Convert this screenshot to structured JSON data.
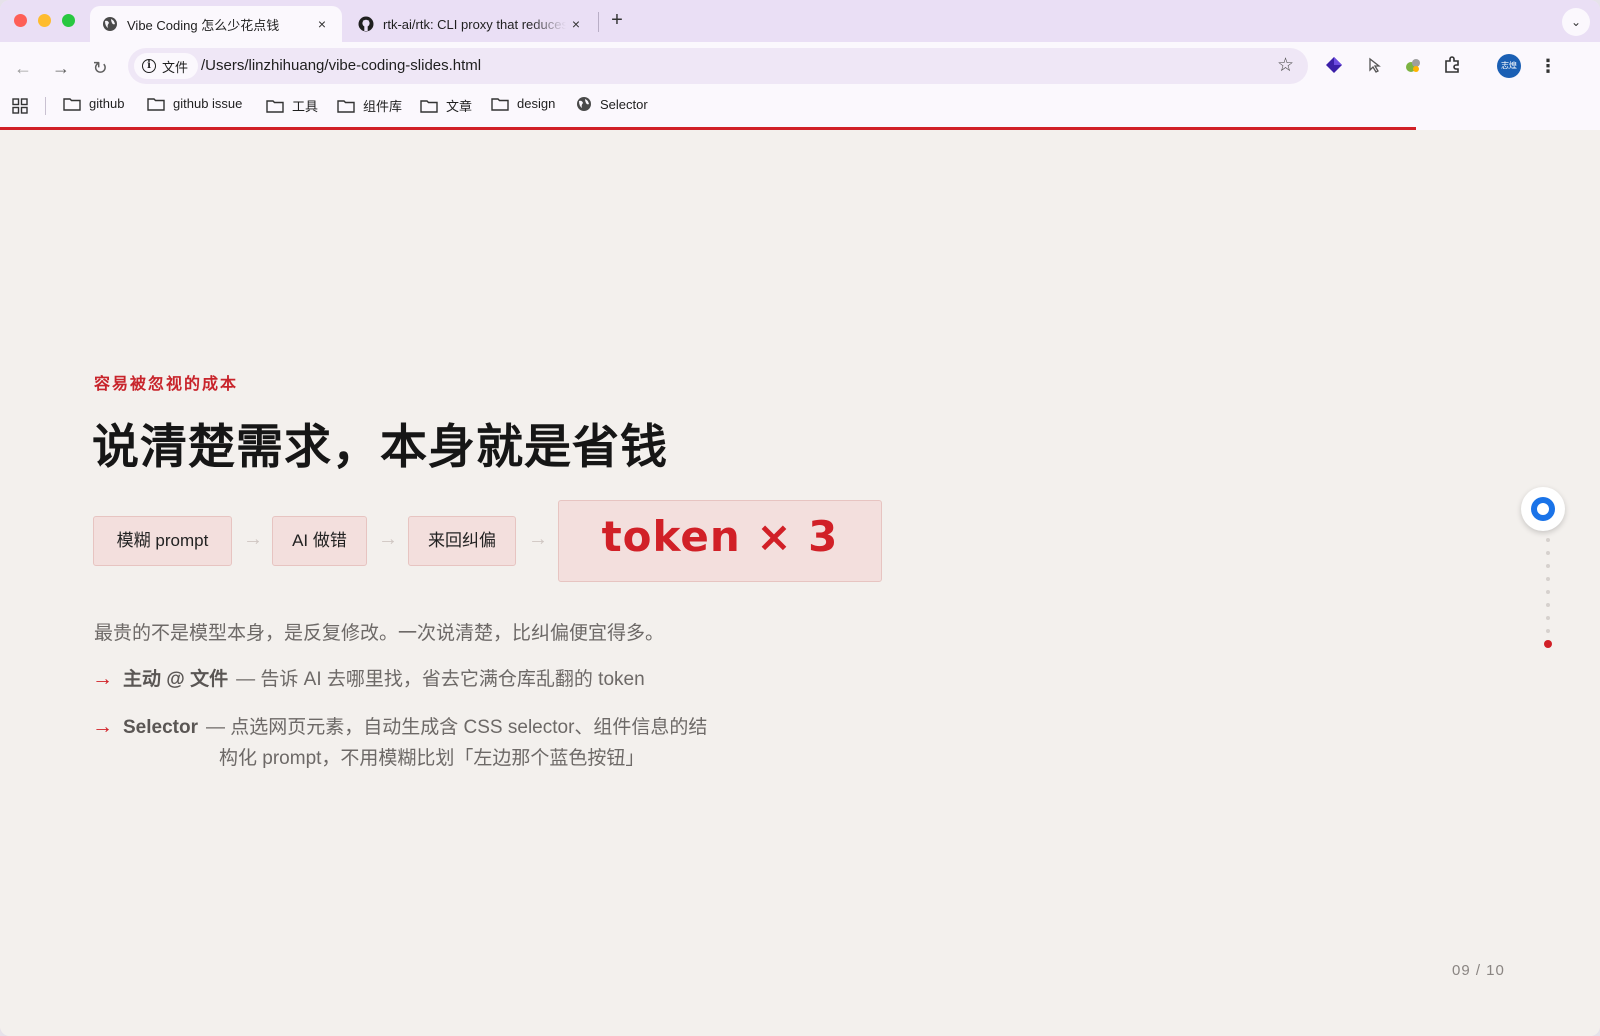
{
  "tabs": [
    {
      "title": "Vibe Coding 怎么少花点钱",
      "close": "×",
      "active": true
    },
    {
      "title": "rtk-ai/rtk: CLI proxy that reduces LLM token consumption",
      "close": "×",
      "active": false
    }
  ],
  "new_tab": "+",
  "tab_list": "⌄",
  "toolbar": {
    "back": "←",
    "forward": "→",
    "reload": "↻",
    "site_chip": "文件",
    "url": "/Users/linzhihuang/vibe-coding-slides.html",
    "bookmark_star": "☆",
    "avatar": "志煌",
    "menu": "⋮"
  },
  "bookmarks": [
    "github",
    "github issue",
    "工具",
    "组件库",
    "文章",
    "design",
    "Selector"
  ],
  "slide": {
    "progress": 0.885,
    "eyebrow": "容易被忽视的成本",
    "headline": "说清楚需求，本身就是省钱",
    "flow": [
      "模糊 prompt",
      "AI 做错",
      "来回纠偏"
    ],
    "flow_arrow": "→",
    "token_multiplier": "token × 3",
    "description": "最贵的不是模型本身，是反复修改。一次说清楚，比纠偏便宜得多。",
    "bullets": [
      {
        "arrow": "→",
        "lead": "主动 @ 文件",
        "text": "— 告诉 AI 去哪里找，省去它满仓库乱翻的 token"
      },
      {
        "arrow": "→",
        "lead": "Selector",
        "text": "— 点选网页元素，自动生成含 CSS selector、组件信息的结",
        "text_cont": "构化 prompt，不用模糊比划「左边那个蓝色按钮」"
      }
    ],
    "page_current": 9,
    "page_total": 10,
    "page_label": "09 / 10"
  },
  "colors": {
    "accent": "#d12027",
    "background": "#f3f0ed",
    "tab_strip": "#eadff5"
  },
  "icons": [
    "globe-icon",
    "github-icon",
    "info-icon",
    "star-icon",
    "extension-icon",
    "folder-icon",
    "apps-grid-icon"
  ]
}
